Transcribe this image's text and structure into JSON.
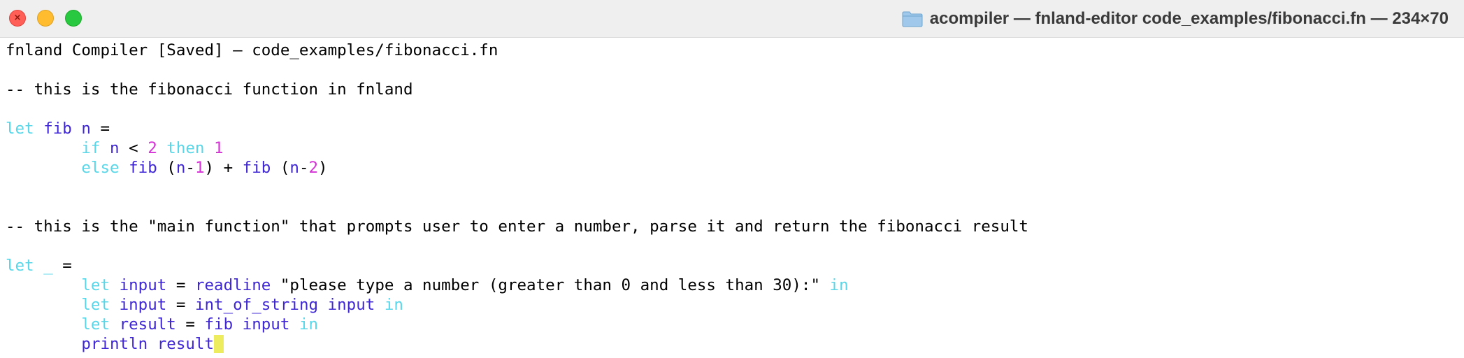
{
  "window": {
    "title": "acompiler — fnland-editor code_examples/fibonacci.fn — 234×70",
    "traffic_lights": {
      "close_symbol": "×"
    },
    "folder_icon": "folder-icon"
  },
  "colors": {
    "keyword": "#59d7e8",
    "identifier": "#3f28d4",
    "number": "#d633d6",
    "cursor": "#ecec5e"
  },
  "editor": {
    "lines": [
      [
        {
          "t": "fnland Compiler [Saved] — code_examples/fibonacci.fn",
          "c": "plain"
        }
      ],
      [],
      [
        {
          "t": "-- this is the fibonacci function in fnland",
          "c": "plain"
        }
      ],
      [],
      [
        {
          "t": "let",
          "c": "kw"
        },
        {
          "t": " ",
          "c": "plain"
        },
        {
          "t": "fib",
          "c": "id"
        },
        {
          "t": " ",
          "c": "plain"
        },
        {
          "t": "n",
          "c": "id"
        },
        {
          "t": " =",
          "c": "plain"
        }
      ],
      [
        {
          "t": "        ",
          "c": "plain"
        },
        {
          "t": "if",
          "c": "kw"
        },
        {
          "t": " ",
          "c": "plain"
        },
        {
          "t": "n",
          "c": "id"
        },
        {
          "t": " < ",
          "c": "plain"
        },
        {
          "t": "2",
          "c": "num"
        },
        {
          "t": " ",
          "c": "plain"
        },
        {
          "t": "then",
          "c": "kw"
        },
        {
          "t": " ",
          "c": "plain"
        },
        {
          "t": "1",
          "c": "num"
        }
      ],
      [
        {
          "t": "        ",
          "c": "plain"
        },
        {
          "t": "else",
          "c": "kw"
        },
        {
          "t": " ",
          "c": "plain"
        },
        {
          "t": "fib",
          "c": "id"
        },
        {
          "t": " (",
          "c": "plain"
        },
        {
          "t": "n",
          "c": "id"
        },
        {
          "t": "-",
          "c": "plain"
        },
        {
          "t": "1",
          "c": "num"
        },
        {
          "t": ") + ",
          "c": "plain"
        },
        {
          "t": "fib",
          "c": "id"
        },
        {
          "t": " (",
          "c": "plain"
        },
        {
          "t": "n",
          "c": "id"
        },
        {
          "t": "-",
          "c": "plain"
        },
        {
          "t": "2",
          "c": "num"
        },
        {
          "t": ")",
          "c": "plain"
        }
      ],
      [],
      [],
      [
        {
          "t": "-- this is the \"main function\" that prompts user to enter a number, parse it and return the fibonacci result",
          "c": "plain"
        }
      ],
      [],
      [
        {
          "t": "let",
          "c": "kw"
        },
        {
          "t": " ",
          "c": "plain"
        },
        {
          "t": "_",
          "c": "kw"
        },
        {
          "t": " =",
          "c": "plain"
        }
      ],
      [
        {
          "t": "        ",
          "c": "plain"
        },
        {
          "t": "let",
          "c": "kw"
        },
        {
          "t": " ",
          "c": "plain"
        },
        {
          "t": "input",
          "c": "id"
        },
        {
          "t": " = ",
          "c": "plain"
        },
        {
          "t": "readline",
          "c": "id"
        },
        {
          "t": " \"please type a number (greater than 0 and less than 30):\" ",
          "c": "plain"
        },
        {
          "t": "in",
          "c": "kw"
        }
      ],
      [
        {
          "t": "        ",
          "c": "plain"
        },
        {
          "t": "let",
          "c": "kw"
        },
        {
          "t": " ",
          "c": "plain"
        },
        {
          "t": "input",
          "c": "id"
        },
        {
          "t": " = ",
          "c": "plain"
        },
        {
          "t": "int_of_string",
          "c": "id"
        },
        {
          "t": " ",
          "c": "plain"
        },
        {
          "t": "input",
          "c": "id"
        },
        {
          "t": " ",
          "c": "plain"
        },
        {
          "t": "in",
          "c": "kw"
        }
      ],
      [
        {
          "t": "        ",
          "c": "plain"
        },
        {
          "t": "let",
          "c": "kw"
        },
        {
          "t": " ",
          "c": "plain"
        },
        {
          "t": "result",
          "c": "id"
        },
        {
          "t": " = ",
          "c": "plain"
        },
        {
          "t": "fib",
          "c": "id"
        },
        {
          "t": " ",
          "c": "plain"
        },
        {
          "t": "input",
          "c": "id"
        },
        {
          "t": " ",
          "c": "plain"
        },
        {
          "t": "in",
          "c": "kw"
        }
      ],
      [
        {
          "t": "        ",
          "c": "plain"
        },
        {
          "t": "println",
          "c": "id"
        },
        {
          "t": " ",
          "c": "plain"
        },
        {
          "t": "result",
          "c": "id"
        },
        {
          "t": " ",
          "c": "cursor"
        }
      ]
    ]
  }
}
